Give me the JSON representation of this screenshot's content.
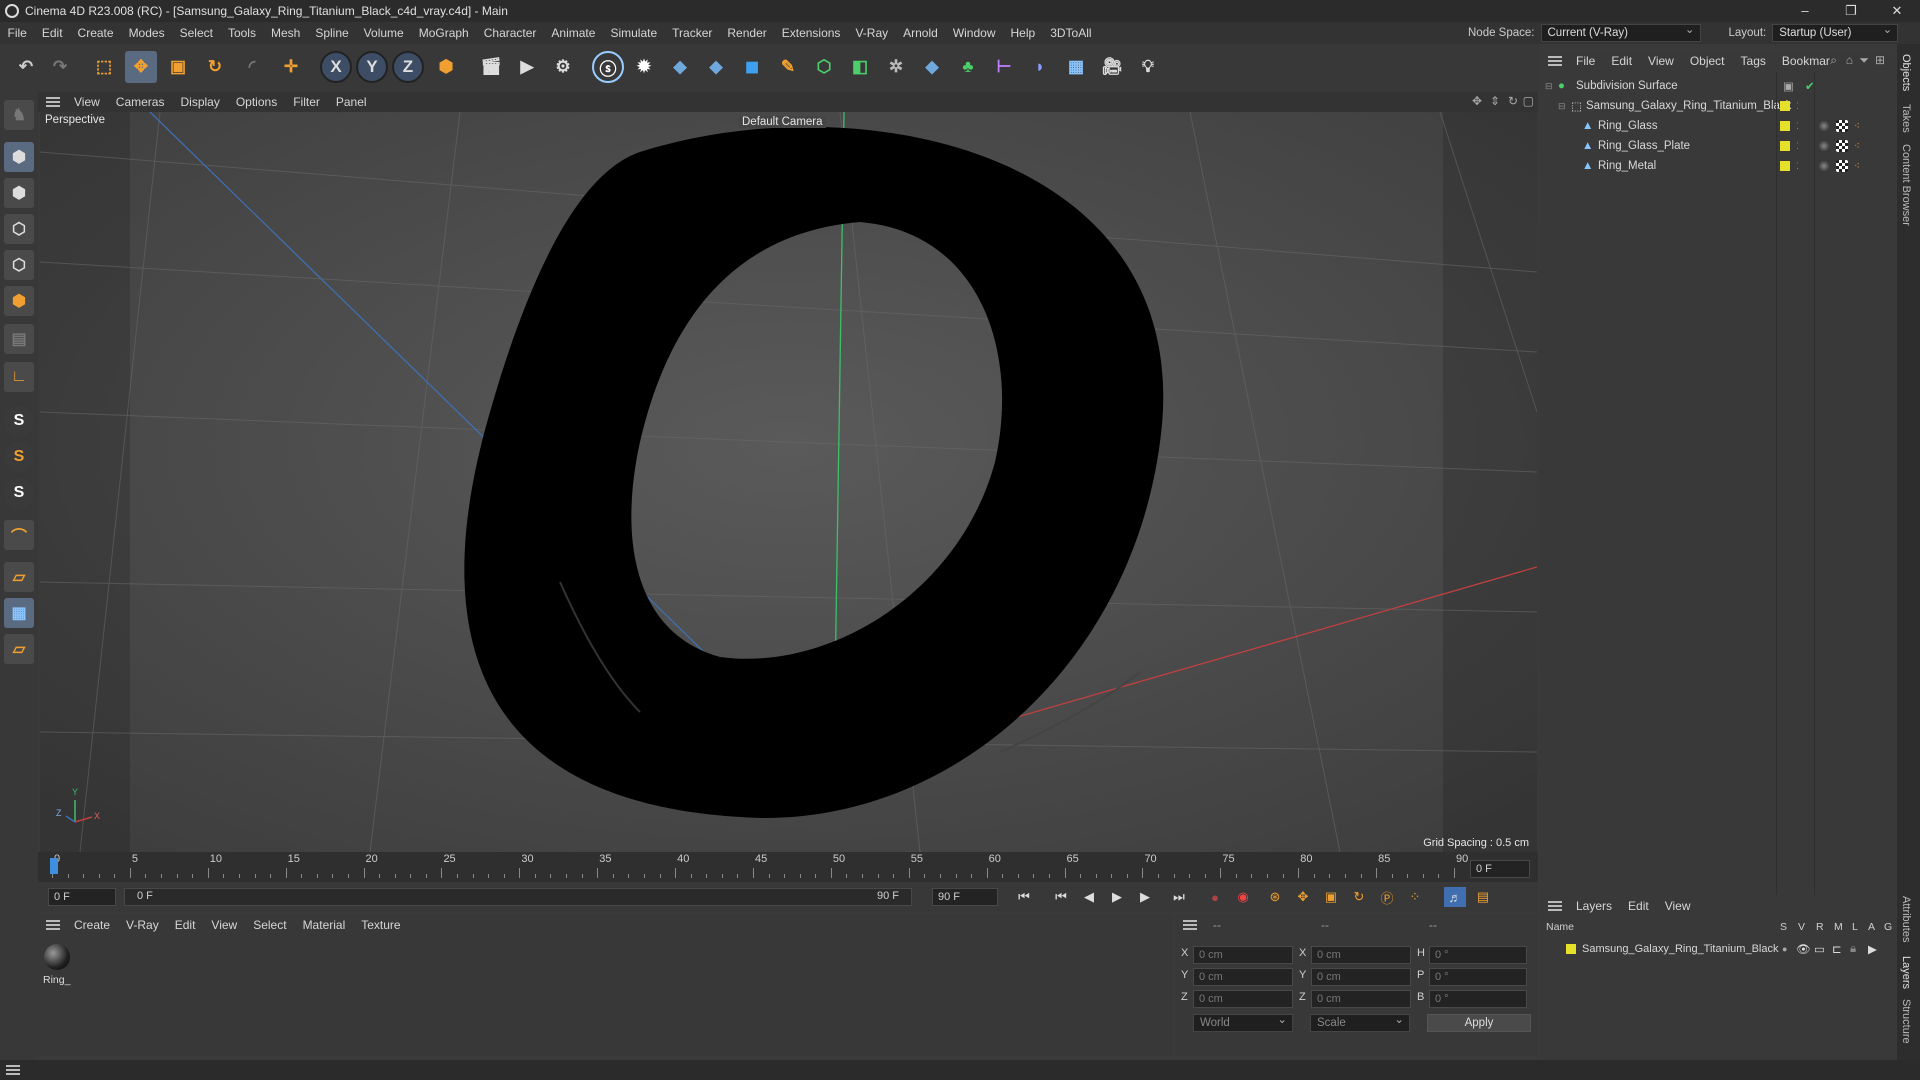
{
  "window": {
    "title": "Cinema 4D R23.008 (RC) - [Samsung_Galaxy_Ring_Titanium_Black_c4d_vray.c4d] - Main",
    "controls": [
      "–",
      "❐",
      "✕"
    ]
  },
  "menubar": {
    "items": [
      "File",
      "Edit",
      "Create",
      "Modes",
      "Select",
      "Tools",
      "Mesh",
      "Spline",
      "Volume",
      "MoGraph",
      "Character",
      "Animate",
      "Simulate",
      "Tracker",
      "Render",
      "Extensions",
      "V-Ray",
      "Arnold",
      "Window",
      "Help",
      "3DToAll"
    ],
    "node_space_label": "Node Space:",
    "node_space_value": "Current (V-Ray)",
    "layout_label": "Layout:",
    "layout_value": "Startup (User)"
  },
  "viewport": {
    "menu": [
      "View",
      "Cameras",
      "Display",
      "Options",
      "Filter",
      "Panel"
    ],
    "label": "Perspective",
    "camera": "Default Camera",
    "grid_spacing": "Grid Spacing : 0.5 cm",
    "axis_labels": {
      "y": "Y",
      "z": "Z",
      "x": "X"
    }
  },
  "timeline": {
    "ticks": [
      "0",
      "5",
      "10",
      "15",
      "20",
      "25",
      "30",
      "35",
      "40",
      "45",
      "50",
      "55",
      "60",
      "65",
      "70",
      "75",
      "80",
      "85",
      "90"
    ],
    "current_frame": "0 F",
    "start_field": "0 F",
    "range_start": "0 F",
    "range_end": "90 F",
    "end_field": "90 F"
  },
  "material_panel": {
    "menu": [
      "Create",
      "V-Ray",
      "Edit",
      "View",
      "Select",
      "Material",
      "Texture"
    ],
    "material_name": "Ring_"
  },
  "attributes": {
    "header_dashes": [
      "--",
      "--",
      "--"
    ],
    "rows": [
      {
        "a": "X",
        "av": "0 cm",
        "b": "X",
        "bv": "0 cm",
        "c": "H",
        "cv": "0 °"
      },
      {
        "a": "Y",
        "av": "0 cm",
        "b": "Y",
        "bv": "0 cm",
        "c": "P",
        "cv": "0 °"
      },
      {
        "a": "Z",
        "av": "0 cm",
        "b": "Z",
        "bv": "0 cm",
        "c": "B",
        "cv": "0 °"
      }
    ],
    "coord_mode": "World",
    "scale_mode": "Scale",
    "apply_label": "Apply"
  },
  "objects_panel": {
    "menu": [
      "File",
      "Edit",
      "View",
      "Object",
      "Tags",
      "Bookmar"
    ],
    "items": [
      {
        "name": "Subdivision Surface",
        "indent": 0
      },
      {
        "name": "Samsung_Galaxy_Ring_Titanium_Black",
        "indent": 1
      },
      {
        "name": "Ring_Glass",
        "indent": 2
      },
      {
        "name": "Ring_Glass_Plate",
        "indent": 2
      },
      {
        "name": "Ring_Metal",
        "indent": 2
      }
    ]
  },
  "layers_panel": {
    "menu": [
      "Layers",
      "Edit",
      "View"
    ],
    "col_name": "Name",
    "cols": [
      "S",
      "V",
      "R",
      "M",
      "L",
      "A",
      "G"
    ],
    "layer_name": "Samsung_Galaxy_Ring_Titanium_Black"
  },
  "side_tabs": [
    "Objects",
    "Takes",
    "Content Browser",
    "Attributes",
    "Layers",
    "Structure"
  ],
  "colors": {
    "accent_blue": "#3f8fe0",
    "layer_yellow": "#e6e02a",
    "x_axis": "#c04040",
    "y_axis": "#3cc06a"
  }
}
